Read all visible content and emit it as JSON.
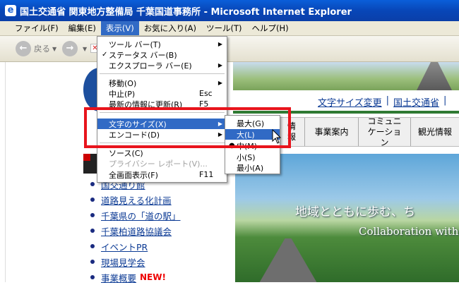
{
  "window": {
    "title": "国土交通省 関東地方整備局 千葉国道事務所 - Microsoft Internet Explorer"
  },
  "menubar": [
    "ファイル(F)",
    "編集(E)",
    "表示(V)",
    "お気に入り(A)",
    "ツール(T)",
    "ヘルプ(H)"
  ],
  "toolbar": {
    "back_label": "戻る"
  },
  "view_menu": {
    "toolbars": "ツール バー(T)",
    "status_bar": "ステータス バー(B)",
    "explorer_bar": "エクスプローラ バー(E)",
    "go_to": "移動(O)",
    "stop": "中止(P)",
    "stop_shortcut": "Esc",
    "refresh": "最新の情報に更新(R)",
    "refresh_shortcut": "F5",
    "text_size": "文字のサイズ(X)",
    "encoding": "エンコード(D)",
    "source": "ソース(C)",
    "privacy_report": "プライバシー レポート(V)...",
    "full_screen": "全画面表示(F)",
    "full_screen_shortcut": "F11"
  },
  "text_size_menu": [
    "最大(G)",
    "大(L)",
    "中(M)",
    "小(S)",
    "最小(A)"
  ],
  "page": {
    "top_links": [
      "文字サイズ変更",
      "国土交通省"
    ],
    "nav_partial": "情報",
    "nav_items": [
      "事業案内",
      "コミュニケーション",
      "観光情報"
    ],
    "hero_text_1": "地域とともに歩む、ち",
    "hero_text_2": "Collaboration with",
    "side_links": [
      "国交通り館",
      "道路見える化計画",
      "千葉県の「道の駅」",
      "千葉柏道路協議会",
      "イベントPR",
      "現場見学会",
      "事業概要"
    ],
    "new_badge": "NEW!"
  },
  "colors": {
    "highlight": "#316ac5",
    "annotation": "#e8141c",
    "titlebar": "#0846b8"
  }
}
